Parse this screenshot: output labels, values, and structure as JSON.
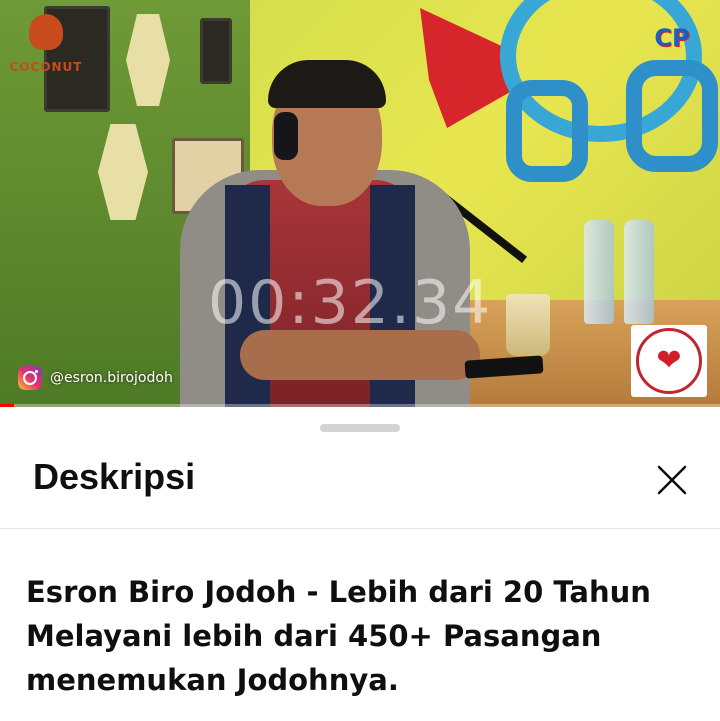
{
  "video": {
    "timecode": "00:32.34",
    "instagram_handle": "@esron.birojodoh",
    "brand_logo_text": "COCONUT",
    "channel_logo_text": "CP",
    "playback_progress": 0.02,
    "accent_color": "#ff0000"
  },
  "sheet": {
    "title": "Deskripsi",
    "close_icon": "close-icon",
    "video_title": "Esron Biro Jodoh - Lebih dari 20 Tahun Melayani lebih dari 450+ Pasangan menemukan Jodohnya."
  }
}
